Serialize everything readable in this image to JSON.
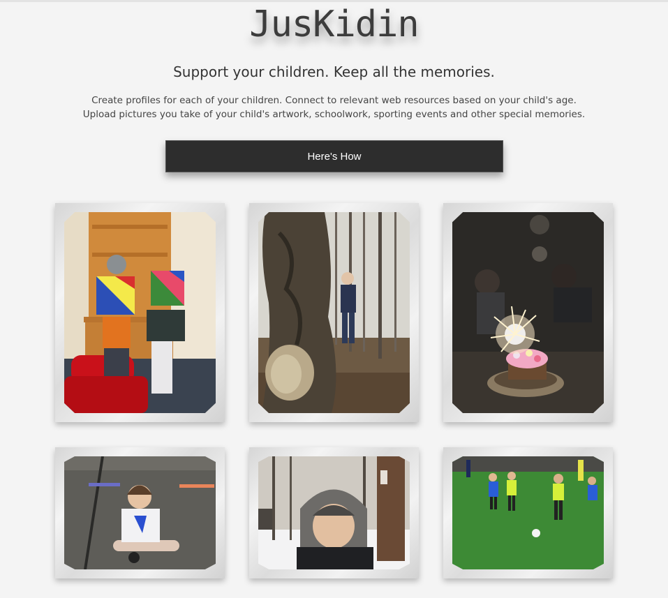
{
  "header": {
    "logo": "JusKidin",
    "tagline": "Support your children. Keep all the memories.",
    "description_line1": "Create profiles for each of your children. Connect to relevant web resources based on your child's age.",
    "description_line2": "Upload pictures you take of your child's artwork, schoolwork, sporting events and other special memories."
  },
  "cta": {
    "label": "Here's How"
  },
  "gallery": {
    "photos": [
      {
        "subject": "children-holding-artwork-photo"
      },
      {
        "subject": "child-behind-tree-photo"
      },
      {
        "subject": "birthday-cake-sparkler-photo"
      },
      {
        "subject": "toddler-sitting-floor-photo"
      },
      {
        "subject": "boy-in-winter-hat-photo"
      },
      {
        "subject": "kids-playing-soccer-photo"
      }
    ]
  },
  "colors": {
    "background": "#f4f4f4",
    "button": "#2d2d2d",
    "text": "#333333"
  }
}
